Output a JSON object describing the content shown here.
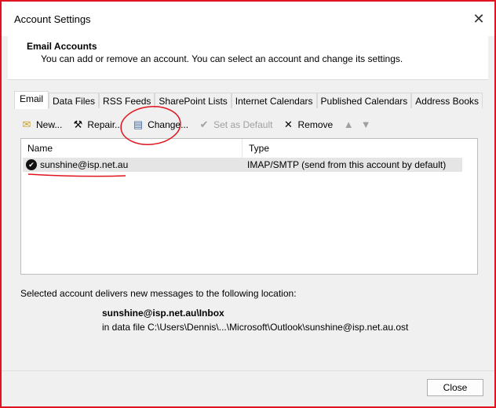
{
  "window": {
    "title": "Account Settings"
  },
  "header": {
    "title": "Email Accounts",
    "subtitle": "You can add or remove an account. You can select an account and change its settings."
  },
  "tabs": [
    {
      "label": "Email",
      "active": true
    },
    {
      "label": "Data Files"
    },
    {
      "label": "RSS Feeds"
    },
    {
      "label": "SharePoint Lists"
    },
    {
      "label": "Internet Calendars"
    },
    {
      "label": "Published Calendars"
    },
    {
      "label": "Address Books"
    }
  ],
  "toolbar": {
    "new": "New...",
    "repair": "Repair...",
    "change": "Change...",
    "set_default": "Set as Default",
    "remove": "Remove"
  },
  "list": {
    "columns": [
      "Name",
      "Type"
    ],
    "rows": [
      {
        "name": "sunshine@isp.net.au",
        "type": "IMAP/SMTP (send from this account by default)"
      }
    ]
  },
  "delivery": {
    "label": "Selected account delivers new messages to the following location:",
    "folder": "sunshine@isp.net.au\\Inbox",
    "file": "in data file C:\\Users\\Dennis\\...\\Microsoft\\Outlook\\sunshine@isp.net.au.ost"
  },
  "buttons": {
    "close": "Close"
  },
  "colors": {
    "annotation": "#e0141e",
    "selection": "#e5e5e5"
  }
}
